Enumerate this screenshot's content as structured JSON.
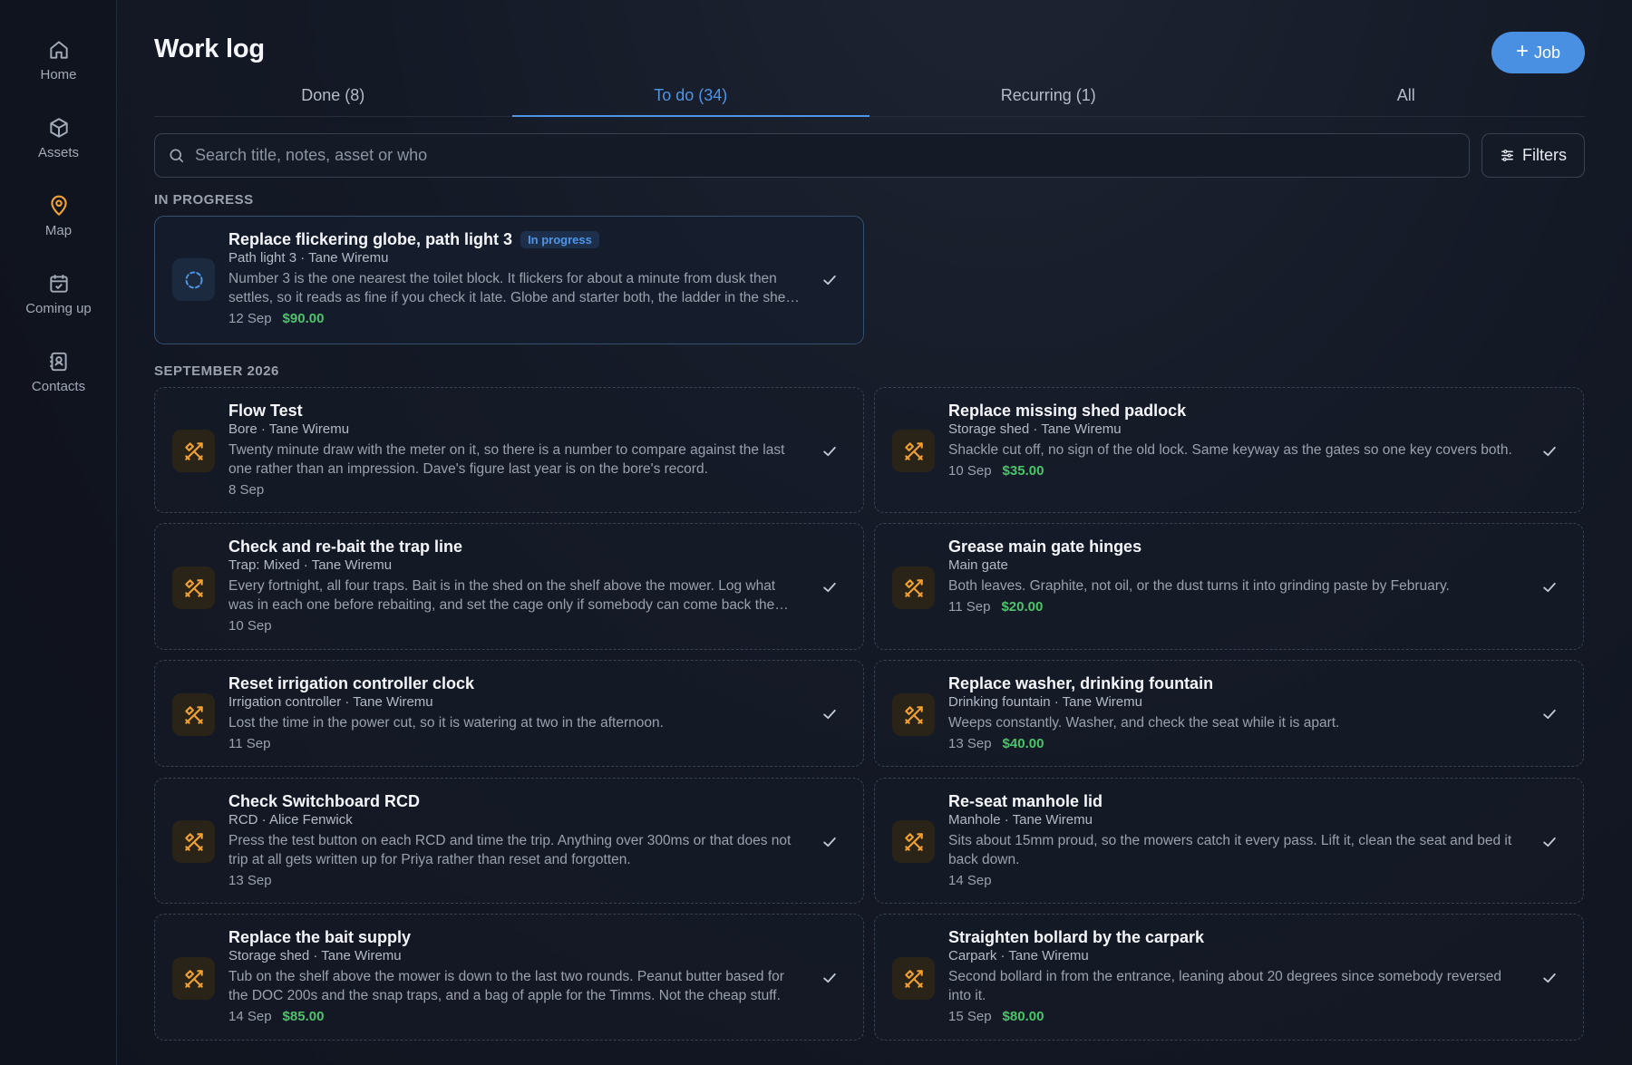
{
  "sidebar": {
    "items": [
      {
        "label": "Home",
        "icon": "home-icon"
      },
      {
        "label": "Assets",
        "icon": "box-icon"
      },
      {
        "label": "Map",
        "icon": "map-pin-icon"
      },
      {
        "label": "Coming up",
        "icon": "calendar-check-icon"
      },
      {
        "label": "Contacts",
        "icon": "contacts-book-icon"
      }
    ]
  },
  "header": {
    "title": "Work log",
    "add_button_label": "Job"
  },
  "tabs": [
    {
      "label": "Done (8)"
    },
    {
      "label": "To do (34)"
    },
    {
      "label": "Recurring (1)"
    },
    {
      "label": "All"
    }
  ],
  "search": {
    "placeholder": "Search title, notes, asset or who",
    "value": "",
    "filters_label": "Filters"
  },
  "sections": {
    "in_progress": "IN PROGRESS",
    "september": "SEPTEMBER 2026"
  },
  "colors": {
    "accent": "#4a90e2",
    "price": "#4cc46a",
    "job_icon": "#f0a030"
  },
  "in_progress_card": {
    "title": "Replace flickering globe, path light 3",
    "badge": "In progress",
    "sub": "Path light 3 · Tane Wiremu",
    "desc": "Number 3 is the one nearest the toilet block. It flickers for about a minute from dusk then settles, so it reads as fine if you check it late. Globe and starter both, the ladder in the shed reaches.",
    "date": "12 Sep",
    "price": "$90.00"
  },
  "cards": [
    {
      "title": "Flow Test",
      "sub": "Bore · Tane Wiremu",
      "desc": "Twenty minute draw with the meter on it, so there is a number to compare against the last one rather than an impression. Dave's figure last year is on the bore's record.",
      "date": "8 Sep",
      "price": ""
    },
    {
      "title": "Replace missing shed padlock",
      "sub": "Storage shed · Tane Wiremu",
      "desc": "Shackle cut off, no sign of the old lock. Same keyway as the gates so one key covers both.",
      "date": "10 Sep",
      "price": "$35.00"
    },
    {
      "title": "Check and re-bait the trap line",
      "sub": "Trap: Mixed · Tane Wiremu",
      "desc": "Every fortnight, all four traps. Bait is in the shed on the shelf above the mower. Log what was in each one before rebaiting, and set the cage only if somebody can come back the next morning.",
      "date": "10 Sep",
      "price": ""
    },
    {
      "title": "Grease main gate hinges",
      "sub": "Main gate",
      "desc": "Both leaves. Graphite, not oil, or the dust turns it into grinding paste by February.",
      "date": "11 Sep",
      "price": "$20.00"
    },
    {
      "title": "Reset irrigation controller clock",
      "sub": "Irrigation controller · Tane Wiremu",
      "desc": "Lost the time in the power cut, so it is watering at two in the afternoon.",
      "date": "11 Sep",
      "price": ""
    },
    {
      "title": "Replace washer, drinking fountain",
      "sub": "Drinking fountain · Tane Wiremu",
      "desc": "Weeps constantly. Washer, and check the seat while it is apart.",
      "date": "13 Sep",
      "price": "$40.00"
    },
    {
      "title": "Check Switchboard RCD",
      "sub": "RCD · Alice Fenwick",
      "desc": "Press the test button on each RCD and time the trip. Anything over 300ms or that does not trip at all gets written up for Priya rather than reset and forgotten.",
      "date": "13 Sep",
      "price": ""
    },
    {
      "title": "Re-seat manhole lid",
      "sub": "Manhole · Tane Wiremu",
      "desc": "Sits about 15mm proud, so the mowers catch it every pass. Lift it, clean the seat and bed it back down.",
      "date": "14 Sep",
      "price": ""
    },
    {
      "title": "Replace the bait supply",
      "sub": "Storage shed · Tane Wiremu",
      "desc": "Tub on the shelf above the mower is down to the last two rounds. Peanut butter based for the DOC 200s and the snap traps, and a bag of apple for the Timms. Not the cheap stuff.",
      "date": "14 Sep",
      "price": "$85.00"
    },
    {
      "title": "Straighten bollard by the carpark",
      "sub": "Carpark · Tane Wiremu",
      "desc": "Second bollard in from the entrance, leaning about 20 degrees since somebody reversed into it.",
      "date": "15 Sep",
      "price": "$80.00"
    }
  ]
}
